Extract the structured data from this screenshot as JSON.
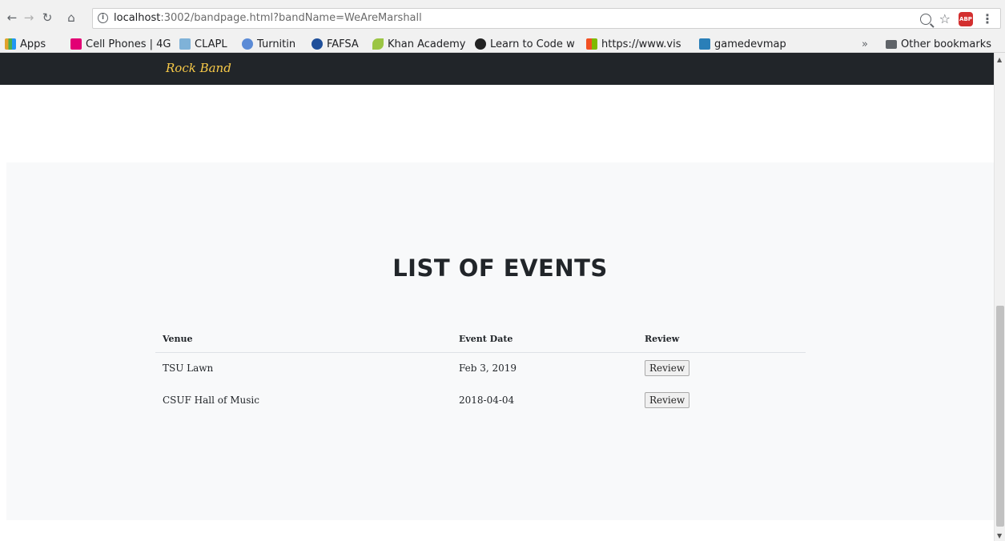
{
  "browser": {
    "url_host": "localhost",
    "url_rest": ":3002/bandpage.html?bandName=WeAreMarshall",
    "bookmarks": [
      {
        "label": "Apps",
        "icon": "apps-grid-icon",
        "color": "#e2a32b"
      },
      {
        "label": "Cell Phones | 4G",
        "icon": "t-mobile-icon",
        "color": "#e20074"
      },
      {
        "label": "CLAPL",
        "icon": "clapl-icon",
        "color": "#7fb2d8"
      },
      {
        "label": "Turnitin",
        "icon": "turnitin-icon",
        "color": "#5b8bd6"
      },
      {
        "label": "FAFSA",
        "icon": "fafsa-icon",
        "color": "#1f4f9a"
      },
      {
        "label": "Khan Academy",
        "icon": "leaf-icon",
        "color": "#9bc544"
      },
      {
        "label": "Learn to Code w",
        "icon": "github-icon",
        "color": "#222222"
      },
      {
        "label": "https://www.vis",
        "icon": "microsoft-icon",
        "color": "#f25022"
      },
      {
        "label": "gamedevmap",
        "icon": "gamedevmap-icon",
        "color": "#2a7fb8"
      }
    ],
    "overflow_label": "»",
    "other_bookmarks": "Other bookmarks"
  },
  "navbar": {
    "brand": "Rock Band"
  },
  "events": {
    "title": "LIST OF EVENTS",
    "columns": [
      "Venue",
      "Event Date",
      "Review"
    ],
    "rows": [
      {
        "venue": "TSU Lawn",
        "date": "Feb 3, 2019",
        "review_label": "Review"
      },
      {
        "venue": "CSUF Hall of Music",
        "date": "2018-04-04",
        "review_label": "Review"
      }
    ]
  },
  "colors": {
    "navbar_bg": "#212529",
    "brand": "#f7c948",
    "section_bg": "#f8f9fa"
  }
}
